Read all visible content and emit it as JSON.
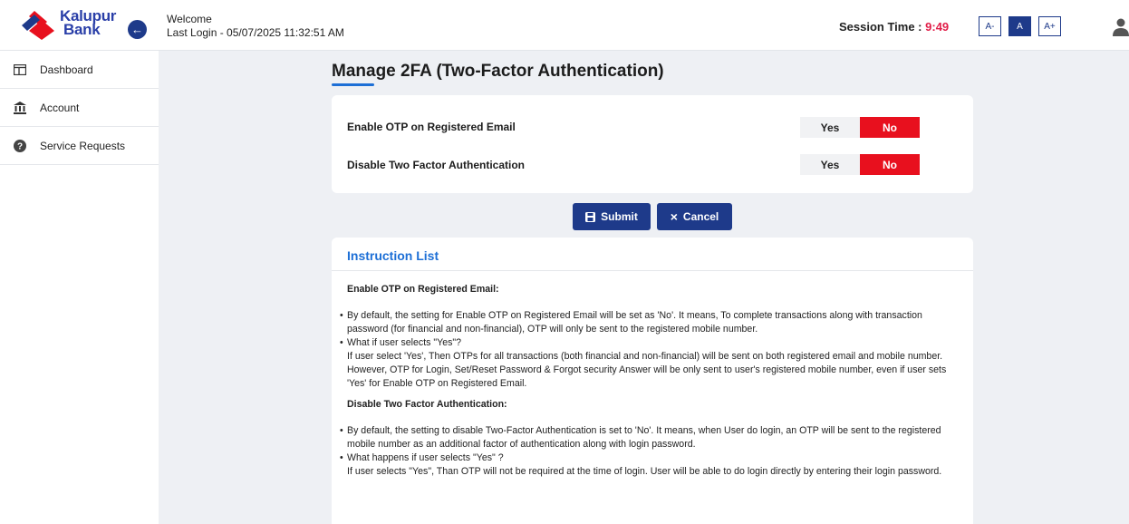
{
  "brand": {
    "name_line1": "Kalupur",
    "name_line2": "Bank",
    "colors": {
      "primary": "#1e3a8a",
      "accent": "#e8101e"
    }
  },
  "header": {
    "welcome": "Welcome",
    "last_login": "Last Login - 05/07/2025 11:32:51 AM",
    "session_label": "Session Time : ",
    "session_time": "9:49",
    "font_decrease": "A-",
    "font_normal": "A",
    "font_increase": "A+"
  },
  "sidebar": {
    "items": [
      {
        "label": "Dashboard",
        "icon": "dashboard-icon"
      },
      {
        "label": "Account",
        "icon": "bank-icon"
      },
      {
        "label": "Service Requests",
        "icon": "help-icon"
      }
    ]
  },
  "main": {
    "title": "Manage 2FA (Two-Factor Authentication)",
    "settings": [
      {
        "label": "Enable OTP on Registered Email",
        "yes": "Yes",
        "no": "No",
        "selected": "No"
      },
      {
        "label": "Disable Two Factor Authentication",
        "yes": "Yes",
        "no": "No",
        "selected": "No"
      }
    ],
    "submit_label": "Submit",
    "cancel_label": "Cancel"
  },
  "instructions": {
    "title": "Instruction List",
    "section1": {
      "heading": "Enable OTP on Registered Email:",
      "bullet1": "By default, the setting for Enable OTP on Registered Email will be set as 'No'. It means, To complete transactions along with transaction password (for financial and non-financial), OTP will only be sent to the registered mobile number.",
      "bullet2": "What if user selects \"Yes\"?",
      "para1": "If user select 'Yes', Then OTPs for all transactions (both financial and non-financial) will be sent on both registered email and mobile number.",
      "para2": "However, OTP for Login, Set/Reset Password & Forgot security Answer will be only sent to user's registered mobile number, even if user sets 'Yes' for Enable OTP on Registered Email."
    },
    "section2": {
      "heading": "Disable Two Factor Authentication:",
      "bullet1": "By default, the setting to disable Two-Factor Authentication is set to 'No'. It means, when User do login, an OTP will be sent to the registered mobile number as an additional factor of authentication along with login password.",
      "bullet2": "What happens if user selects \"Yes\" ?",
      "para1": "If user selects \"Yes\", Than OTP will not be required at the time of login. User will be able to do login directly by entering their login password."
    }
  }
}
